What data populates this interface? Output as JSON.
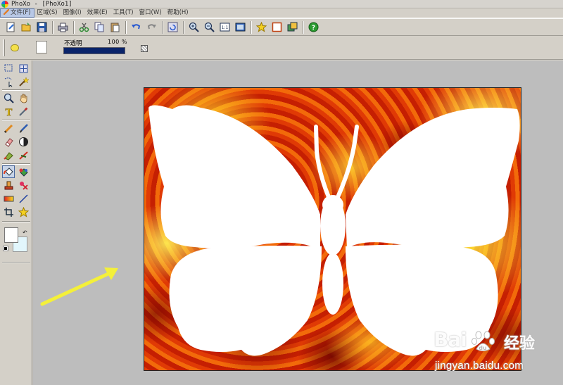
{
  "window": {
    "title": "PhoXo - [PhoXo1]"
  },
  "menu": [
    {
      "label": "文件(F)",
      "active": true
    },
    {
      "label": "区域(S)",
      "active": false
    },
    {
      "label": "图像(I)",
      "active": false
    },
    {
      "label": "效果(E)",
      "active": false
    },
    {
      "label": "工具(T)",
      "active": false
    },
    {
      "label": "窗口(W)",
      "active": false
    },
    {
      "label": "帮助(H)",
      "active": false
    }
  ],
  "toolbar": {
    "icons": [
      "new-file-icon",
      "open-folder-icon",
      "save-icon",
      "print-icon",
      "cut-icon",
      "copy-icon",
      "paste-icon",
      "undo-icon",
      "redo-icon",
      "refresh-icon",
      "zoom-in-icon",
      "zoom-out-icon",
      "actual-size-icon",
      "fit-window-icon",
      "favorite-star-icon",
      "frame-icon",
      "layers-icon",
      "help-icon"
    ]
  },
  "properties": {
    "opacity_label": "不透明",
    "opacity_value": "100 %",
    "opacity_level": 1.0
  },
  "tools": [
    "rect-select-tool",
    "move-tool",
    "lasso-tool",
    "magic-wand-tool",
    "zoom-tool",
    "hand-tool",
    "text-tool",
    "eyedropper-tool",
    "pencil-tool",
    "brush-tool",
    "eraser-tool",
    "contrast-tool",
    "smudge-tool",
    "sharpen-tool",
    "fill-tool",
    "gradient-fill-tool",
    "stamp-tool",
    "red-eye-tool",
    "gradient-tool",
    "line-tool",
    "crop-tool",
    "shape-star-tool"
  ],
  "colors": {
    "foreground": "#ffffff",
    "background": "#e2f6fc",
    "arrow": "#f4f03a"
  },
  "watermark": {
    "logo": "Bai",
    "logo2": "经验",
    "url": "jingyan.baidu.com"
  }
}
